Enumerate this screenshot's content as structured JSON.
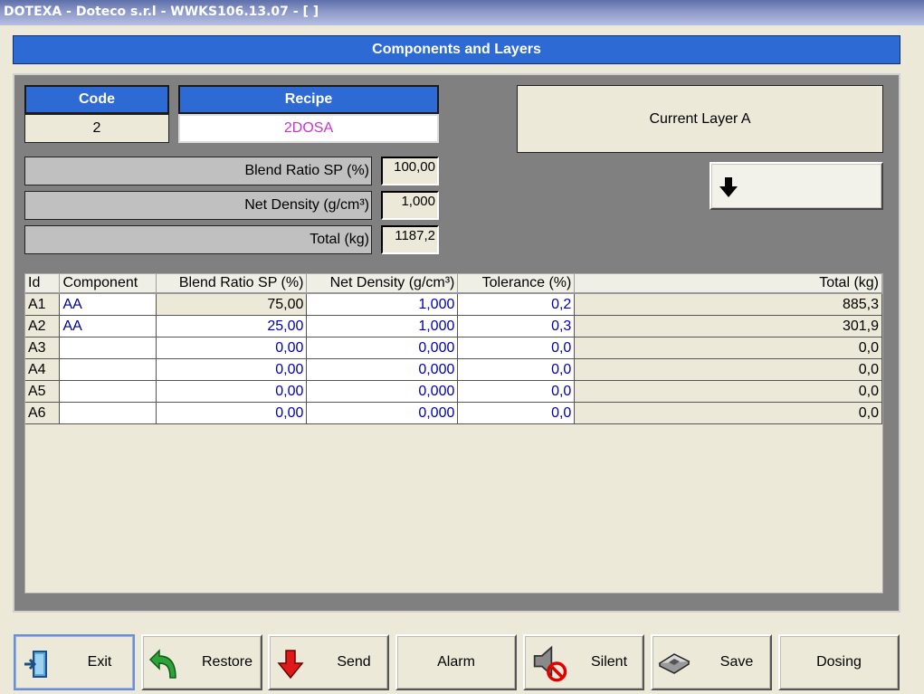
{
  "window": {
    "title": "DOTEXA - Doteco s.r.l - WWKS106.13.07 - [ ]"
  },
  "header": {
    "title": "Components and Layers"
  },
  "recipe": {
    "code_label": "Code",
    "code_value": "2",
    "recipe_label": "Recipe",
    "recipe_value": "2DOSA"
  },
  "summary": {
    "blend_ratio_label": "Blend Ratio SP (%)",
    "blend_ratio_value": "100,00",
    "net_density_label": "Net Density (g/cm³)",
    "net_density_value": "1,000",
    "total_label": "Total (kg)",
    "total_value": "1187,2"
  },
  "layer": {
    "current_label": "Current Layer A"
  },
  "table": {
    "headers": [
      "Id",
      "Component",
      "Blend Ratio SP (%)",
      "Net Density (g/cm³)",
      "Tolerance (%)",
      "Total (kg)"
    ],
    "rows": [
      {
        "id": "A1",
        "component": "AA",
        "blend": "75,00",
        "density": "1,000",
        "tolerance": "0,2",
        "total": "885,3"
      },
      {
        "id": "A2",
        "component": "AA",
        "blend": "25,00",
        "density": "1,000",
        "tolerance": "0,3",
        "total": "301,9"
      },
      {
        "id": "A3",
        "component": "",
        "blend": "0,00",
        "density": "0,000",
        "tolerance": "0,0",
        "total": "0,0"
      },
      {
        "id": "A4",
        "component": "",
        "blend": "0,00",
        "density": "0,000",
        "tolerance": "0,0",
        "total": "0,0"
      },
      {
        "id": "A5",
        "component": "",
        "blend": "0,00",
        "density": "0,000",
        "tolerance": "0,0",
        "total": "0,0"
      },
      {
        "id": "A6",
        "component": "",
        "blend": "0,00",
        "density": "0,000",
        "tolerance": "0,0",
        "total": "0,0"
      }
    ]
  },
  "buttons": {
    "exit": "Exit",
    "restore": "Restore",
    "send": "Send",
    "alarm": "Alarm",
    "silent": "Silent",
    "save": "Save",
    "dosing": "Dosing"
  },
  "colors": {
    "accent": "#2e6ad4",
    "recipe_text": "#cc33cc",
    "value_text": "#0000b0"
  },
  "icons": {
    "layer_down": "arrow-down-icon",
    "exit": "exit-door-icon",
    "restore": "undo-arrow-icon",
    "send": "red-down-arrow-icon",
    "silent": "speaker-muted-icon",
    "save": "disk-icon"
  }
}
